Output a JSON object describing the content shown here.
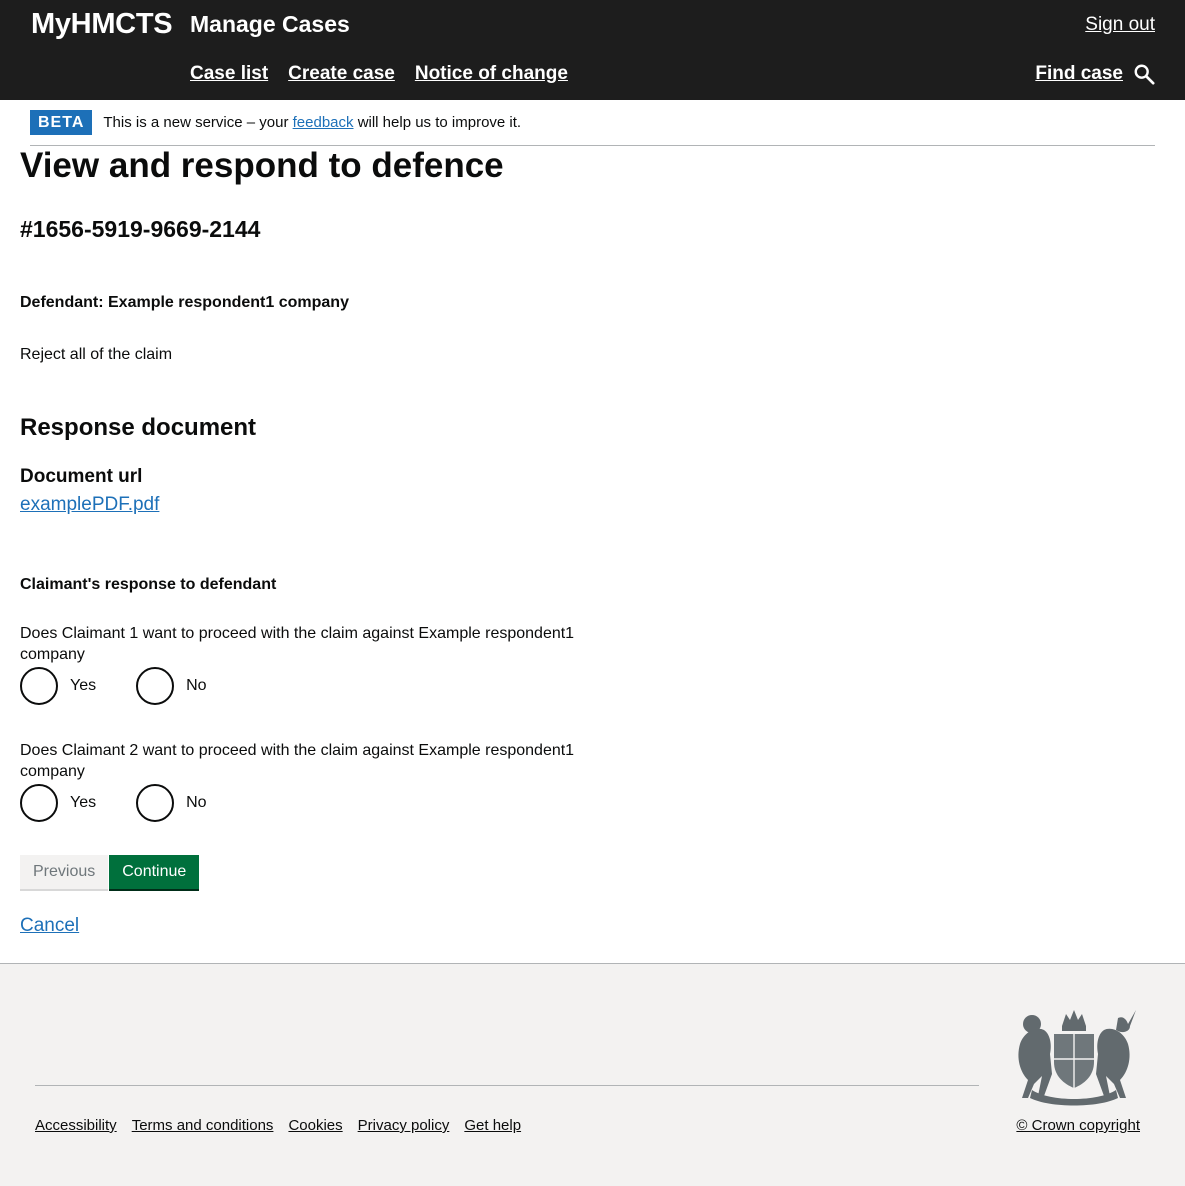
{
  "header": {
    "brand": "MyHMCTS",
    "service_name": "Manage Cases",
    "sign_out": "Sign out",
    "nav": [
      "Case list",
      "Create case",
      "Notice of change"
    ],
    "find_case": "Find case"
  },
  "phase_banner": {
    "tag": "BETA",
    "text_before": "This is a new service – your",
    "link": "feedback",
    "text_after": "will help us to improve it."
  },
  "main": {
    "title": "View and respond to defence",
    "case_reference": "#1656-5919-9669-2144",
    "defendant_label": "Defendant: Example respondent1 company",
    "defence_type": "Reject all of the claim",
    "response_heading": "Response document",
    "document_label": "Document url",
    "document_link": "examplePDF.pdf",
    "claimant_heading": "Claimant's response to defendant",
    "questions": [
      {
        "text": "Does Claimant 1 want to proceed with the claim against Example respondent1 company",
        "options": [
          "Yes",
          "No"
        ]
      },
      {
        "text": "Does Claimant 2 want to proceed with the claim against Example respondent1 company",
        "options": [
          "Yes",
          "No"
        ]
      }
    ],
    "previous_button": "Previous",
    "continue_button": "Continue",
    "cancel_link": "Cancel"
  },
  "footer": {
    "links": [
      "Accessibility",
      "Terms and conditions",
      "Cookies",
      "Privacy policy",
      "Get help"
    ],
    "copyright": "© Crown copyright",
    "crest": "royal-coat-of-arms"
  },
  "colors": {
    "header_bg": "#1d1d1d",
    "link": "#1d70b8",
    "tag_bg": "#1d70b8",
    "continue_bg": "#00703c",
    "footer_bg": "#f3f2f1"
  }
}
